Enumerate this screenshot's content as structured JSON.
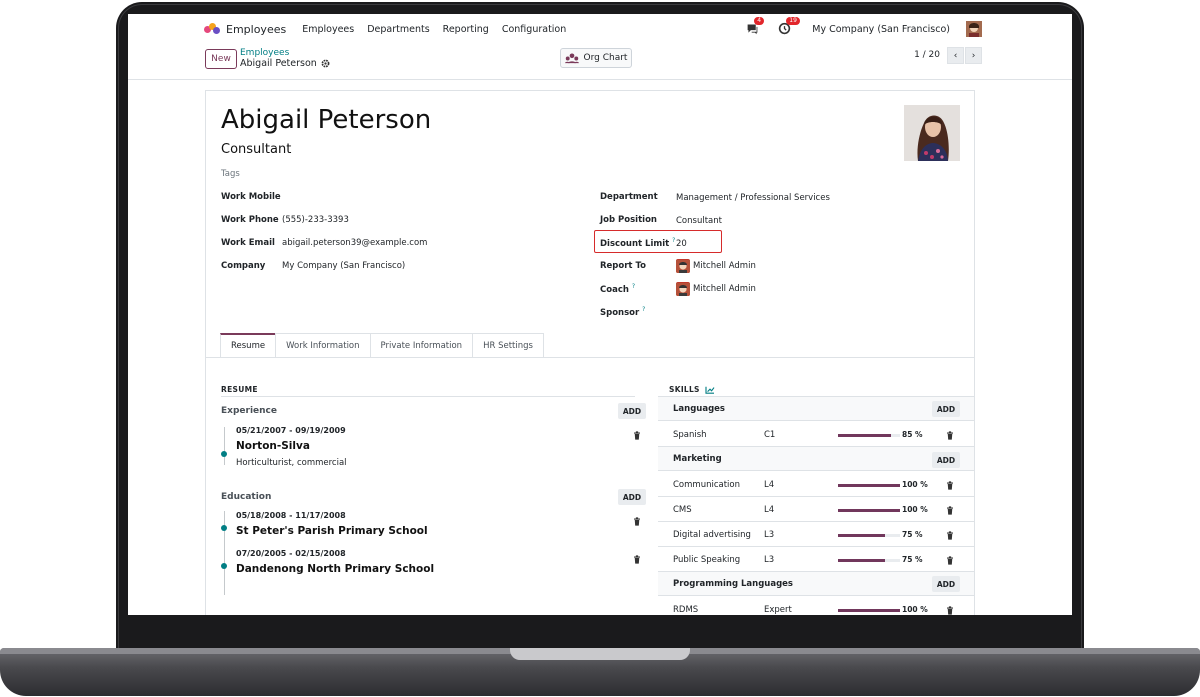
{
  "navbar": {
    "app_title": "Employees",
    "menu": [
      "Employees",
      "Departments",
      "Reporting",
      "Configuration"
    ],
    "messages_badge": "4",
    "activities_badge": "19",
    "company": "My Company (San Francisco)"
  },
  "control_panel": {
    "new_label": "New",
    "breadcrumb_parent": "Employees",
    "breadcrumb_current": "Abigail Peterson",
    "org_chart_label": "Org Chart",
    "pager": "1 / 20"
  },
  "employee": {
    "name": "Abigail Peterson",
    "job_title": "Consultant",
    "tags_placeholder": "Tags",
    "left_fields": [
      {
        "label": "Work Mobile",
        "value": ""
      },
      {
        "label": "Work Phone",
        "value": "(555)-233-3393"
      },
      {
        "label": "Work Email",
        "value": "abigail.peterson39@example.com"
      },
      {
        "label": "Company",
        "value": "My Company (San Francisco)"
      }
    ],
    "right_fields": [
      {
        "label": "Department",
        "value": "Management / Professional Services",
        "help": ""
      },
      {
        "label": "Job Position",
        "value": "Consultant",
        "help": ""
      },
      {
        "label": "Discount Limit",
        "value": "20",
        "help": "?"
      },
      {
        "label": "Report To",
        "value": "Mitchell Admin",
        "help": ""
      },
      {
        "label": "Coach",
        "value": "Mitchell Admin",
        "help": "?"
      },
      {
        "label": "Sponsor",
        "value": "",
        "help": "?"
      }
    ]
  },
  "tabs": [
    "Resume",
    "Work Information",
    "Private Information",
    "HR Settings"
  ],
  "resume": {
    "title": "RESUME",
    "add_label": "ADD",
    "experience_title": "Experience",
    "education_title": "Education",
    "experience": [
      {
        "date": "05/21/2007 - 09/19/2009",
        "title": "Norton-Silva",
        "desc": "Horticulturist, commercial"
      }
    ],
    "education": [
      {
        "date": "05/18/2008 - 11/17/2008",
        "title": "St Peter's Parish Primary School"
      },
      {
        "date": "07/20/2005 - 02/15/2008",
        "title": "Dandenong North Primary School"
      }
    ]
  },
  "skills": {
    "title": "SKILLS",
    "add_label": "ADD",
    "groups": [
      {
        "name": "Languages",
        "items": [
          {
            "name": "Spanish",
            "level": "C1",
            "pct": "85 %",
            "value": 85
          }
        ]
      },
      {
        "name": "Marketing",
        "items": [
          {
            "name": "Communication",
            "level": "L4",
            "pct": "100 %",
            "value": 100
          },
          {
            "name": "CMS",
            "level": "L4",
            "pct": "100 %",
            "value": 100
          },
          {
            "name": "Digital advertising",
            "level": "L3",
            "pct": "75 %",
            "value": 75
          },
          {
            "name": "Public Speaking",
            "level": "L3",
            "pct": "75 %",
            "value": 75
          }
        ]
      },
      {
        "name": "Programming Languages",
        "items": [
          {
            "name": "RDMS",
            "level": "Expert",
            "pct": "100 %",
            "value": 100
          }
        ]
      }
    ]
  },
  "colors": {
    "brand": "#71375c",
    "teal": "#017e84",
    "highlight": "#d62b2b"
  }
}
